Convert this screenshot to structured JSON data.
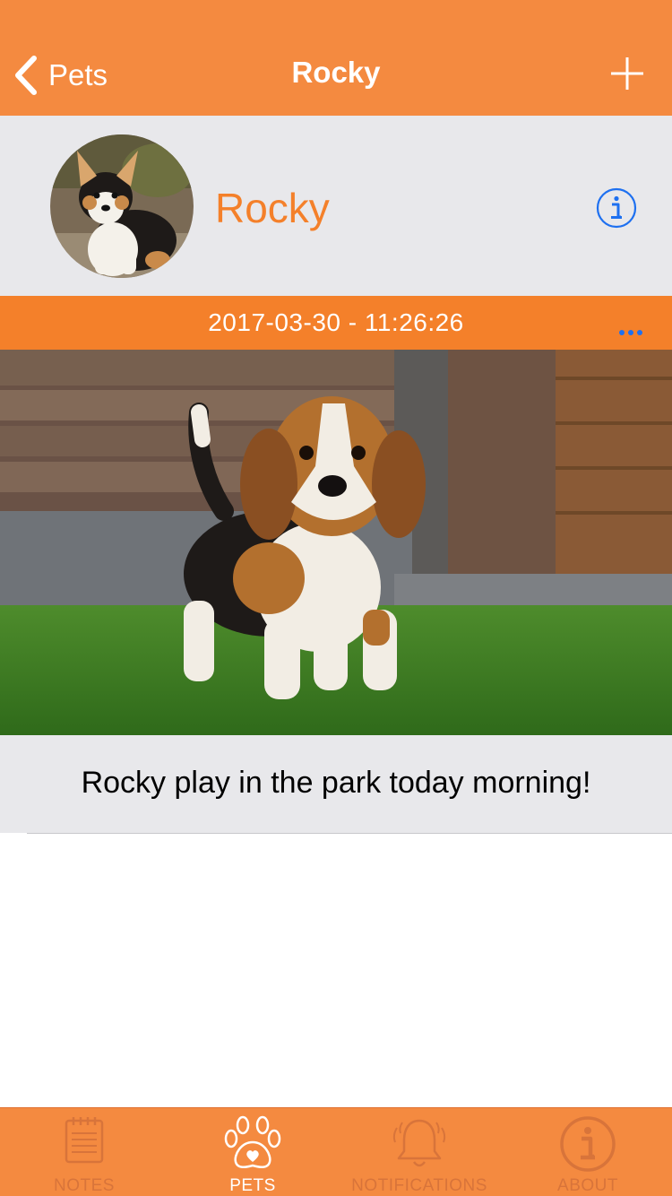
{
  "colors": {
    "nav_orange": "#F48A40",
    "accent_orange": "#F4802A",
    "light_gray": "#E8E8EB",
    "ios_blue": "#1E70F0"
  },
  "navbar": {
    "back_label": "Pets",
    "title": "Rocky",
    "back_icon": "chevron-left-icon",
    "add_icon": "plus-icon"
  },
  "profile": {
    "name": "Rocky",
    "avatar_icon": "corgi-puppy-photo",
    "info_icon": "info-icon"
  },
  "entry": {
    "timestamp": "2017-03-30 - 11:26:26",
    "more_icon": "ellipsis-icon",
    "photo": "beagle-puppy-photo",
    "caption": "Rocky play in the park today morning!"
  },
  "tabbar": {
    "tabs": [
      {
        "label": "NOTES",
        "icon": "notepad-icon",
        "active": false
      },
      {
        "label": "PETS",
        "icon": "paw-icon",
        "active": true
      },
      {
        "label": "NOTIFICATIONS",
        "icon": "bell-icon",
        "active": false
      },
      {
        "label": "ABOUT",
        "icon": "info-circle-icon",
        "active": false
      }
    ]
  }
}
